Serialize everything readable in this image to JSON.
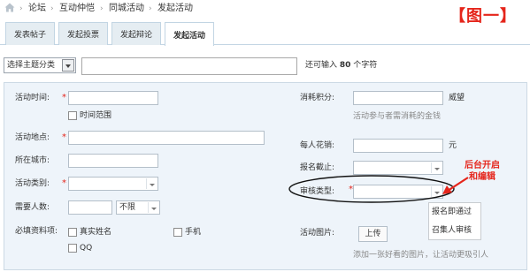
{
  "breadcrumb": {
    "home_icon": "home-icon",
    "items": [
      "论坛",
      "互动仲恺",
      "同城活动",
      "发起活动"
    ]
  },
  "annotation": {
    "title": "【图一】",
    "label_line1": "后台开启",
    "label_line2": "和编辑",
    "color": "#e5251b"
  },
  "tabs": [
    {
      "label": "发表帖子",
      "active": false
    },
    {
      "label": "发起投票",
      "active": false
    },
    {
      "label": "发起辩论",
      "active": false
    },
    {
      "label": "发起活动",
      "active": true
    }
  ],
  "topic": {
    "category_select": "选择主题分类",
    "subject_value": "",
    "hint_prefix": "还可输入",
    "hint_count": "80",
    "hint_suffix": "个字符"
  },
  "form": {
    "time_label": "活动时间:",
    "time_range_label": "时间范围",
    "place_label": "活动地点:",
    "city_label": "所在城市:",
    "category_label": "活动类别:",
    "people_label": "需要人数:",
    "people_limit": "不限",
    "required_info_label": "必填资料项:",
    "realname_label": "真实姓名",
    "phone_label": "手机",
    "qq_label": "QQ",
    "credits_label": "消耗积分:",
    "credits_unit": "威望",
    "credits_note": "活动参与者需消耗的金钱",
    "cost_label": "每人花销:",
    "cost_unit": "元",
    "deadline_label": "报名截止:",
    "review_label": "审核类型:",
    "review_options": [
      "报名即通过",
      "召集人审核"
    ],
    "image_label": "活动图片:",
    "upload_button": "上传",
    "image_note": "添加一张好看的图片，让活动更吸引人"
  }
}
